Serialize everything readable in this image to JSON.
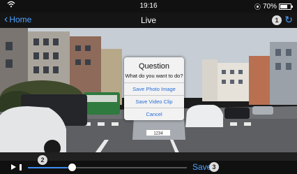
{
  "status_bar": {
    "time": "19:16",
    "battery_text": "70%",
    "battery_level": 0.7,
    "wifi_icon": "wifi-icon"
  },
  "nav": {
    "back_label": "Home",
    "title": "Live",
    "badge_1": "1",
    "refresh_icon": "refresh-icon"
  },
  "dialog": {
    "title": "Question",
    "message": "What do you want to do?",
    "buttons": [
      "Save Photo Image",
      "Save Video Clip",
      "Cancel"
    ]
  },
  "controls": {
    "badge_2": "2",
    "progress": 0.28,
    "save_label": "Save",
    "badge_3": "3"
  },
  "scene": {
    "plate_text": "1234"
  },
  "colors": {
    "accent": "#4da3ff",
    "progress_fill": "#3e8ef0"
  }
}
